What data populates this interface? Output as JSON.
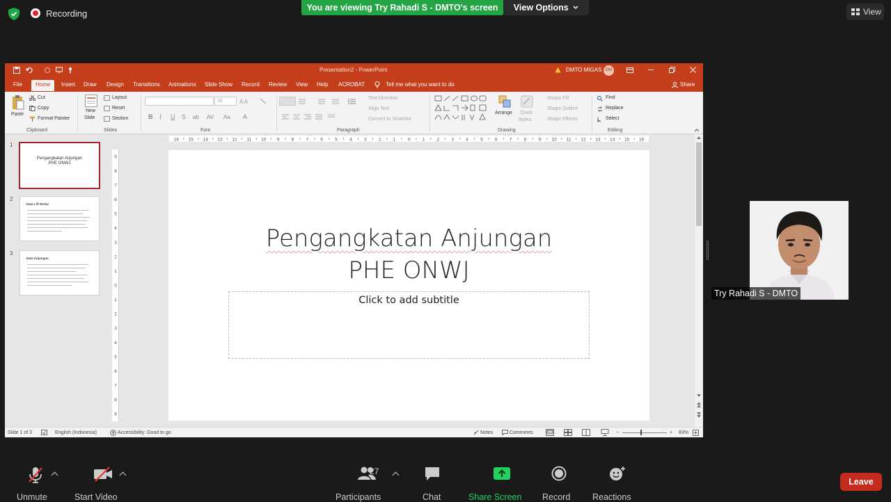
{
  "zoom": {
    "recording_label": "Recording",
    "viewing_banner": "You are viewing Try Rahadi S - DMTO's screen",
    "view_options": "View Options",
    "view_button": "View",
    "participant_name": "Try Rahadi S - DMTO",
    "toolbar": {
      "unmute": "Unmute",
      "start_video": "Start Video",
      "participants": "Participants",
      "participants_count": "27",
      "chat": "Chat",
      "share_screen": "Share Screen",
      "record": "Record",
      "reactions": "Reactions",
      "leave": "Leave"
    },
    "colors": {
      "share_green": "#23a546",
      "leave_red": "#c42b1c",
      "recording_red": "#e02828"
    }
  },
  "ppt": {
    "window_title": "Presentation2  -  PowerPoint",
    "account": "DMTO MIGAS",
    "avatar_initials": "DM",
    "tabs": [
      "File",
      "Home",
      "Insert",
      "Draw",
      "Design",
      "Transitions",
      "Animations",
      "Slide Show",
      "Record",
      "Review",
      "View",
      "Help",
      "ACROBAT"
    ],
    "active_tab": "Home",
    "tell_me": "Tell me what you want to do",
    "share": "Share",
    "ribbon": {
      "paste": "Paste",
      "cut": "Cut",
      "copy": "Copy",
      "format_painter": "Format Painter",
      "clipboard": "Clipboard",
      "new_slide_1": "New",
      "new_slide_2": "Slide",
      "layout": "Layout",
      "reset": "Reset",
      "section": "Section",
      "slides": "Slides",
      "font": "Font",
      "font_size": "28",
      "text_direction": "Text Direction",
      "align_text": "Align Text",
      "convert_smartart": "Convert to SmartArt",
      "paragraph": "Paragraph",
      "arrange": "Arrange",
      "quick_styles_1": "Quick",
      "quick_styles_2": "Styles",
      "shape_fill": "Shape Fill",
      "shape_outline": "Shape Outline",
      "shape_effects": "Shape Effects",
      "drawing": "Drawing",
      "find": "Find",
      "replace": "Replace",
      "select": "Select",
      "editing": "Editing"
    },
    "ruler_numbers": [
      "16",
      "15",
      "14",
      "13",
      "12",
      "11",
      "10",
      "9",
      "8",
      "7",
      "6",
      "5",
      "4",
      "3",
      "2",
      "1",
      "0",
      "1",
      "2",
      "3",
      "4",
      "5",
      "6",
      "7",
      "8",
      "9",
      "10",
      "11",
      "12",
      "13",
      "14",
      "15",
      "16"
    ],
    "vruler_numbers": [
      "9",
      "8",
      "7",
      "6",
      "5",
      "4",
      "3",
      "2",
      "1",
      "0",
      "1",
      "2",
      "3",
      "4",
      "5",
      "6",
      "7",
      "8",
      "9"
    ],
    "thumbnails": [
      {
        "num": "1",
        "title_line1": "Pengangkatan Anjungan",
        "title_line2": "PHE ONWJ"
      },
      {
        "num": "2",
        "heading": "Data Lift Berlai"
      },
      {
        "num": "3",
        "heading": "Data Anjungan"
      }
    ],
    "slide": {
      "title_line1": "Pengangkatan Anjungan",
      "title_line2": "PHE ONWJ",
      "subtitle_placeholder": "Click to add subtitle"
    },
    "status": {
      "slide_info": "Slide 1 of 3",
      "language": "English (Indonesia)",
      "accessibility": "Accessibility: Good to go",
      "notes": "Notes",
      "comments": "Comments",
      "zoom": "83%"
    },
    "colors": {
      "accent": "#c43e1c"
    }
  }
}
